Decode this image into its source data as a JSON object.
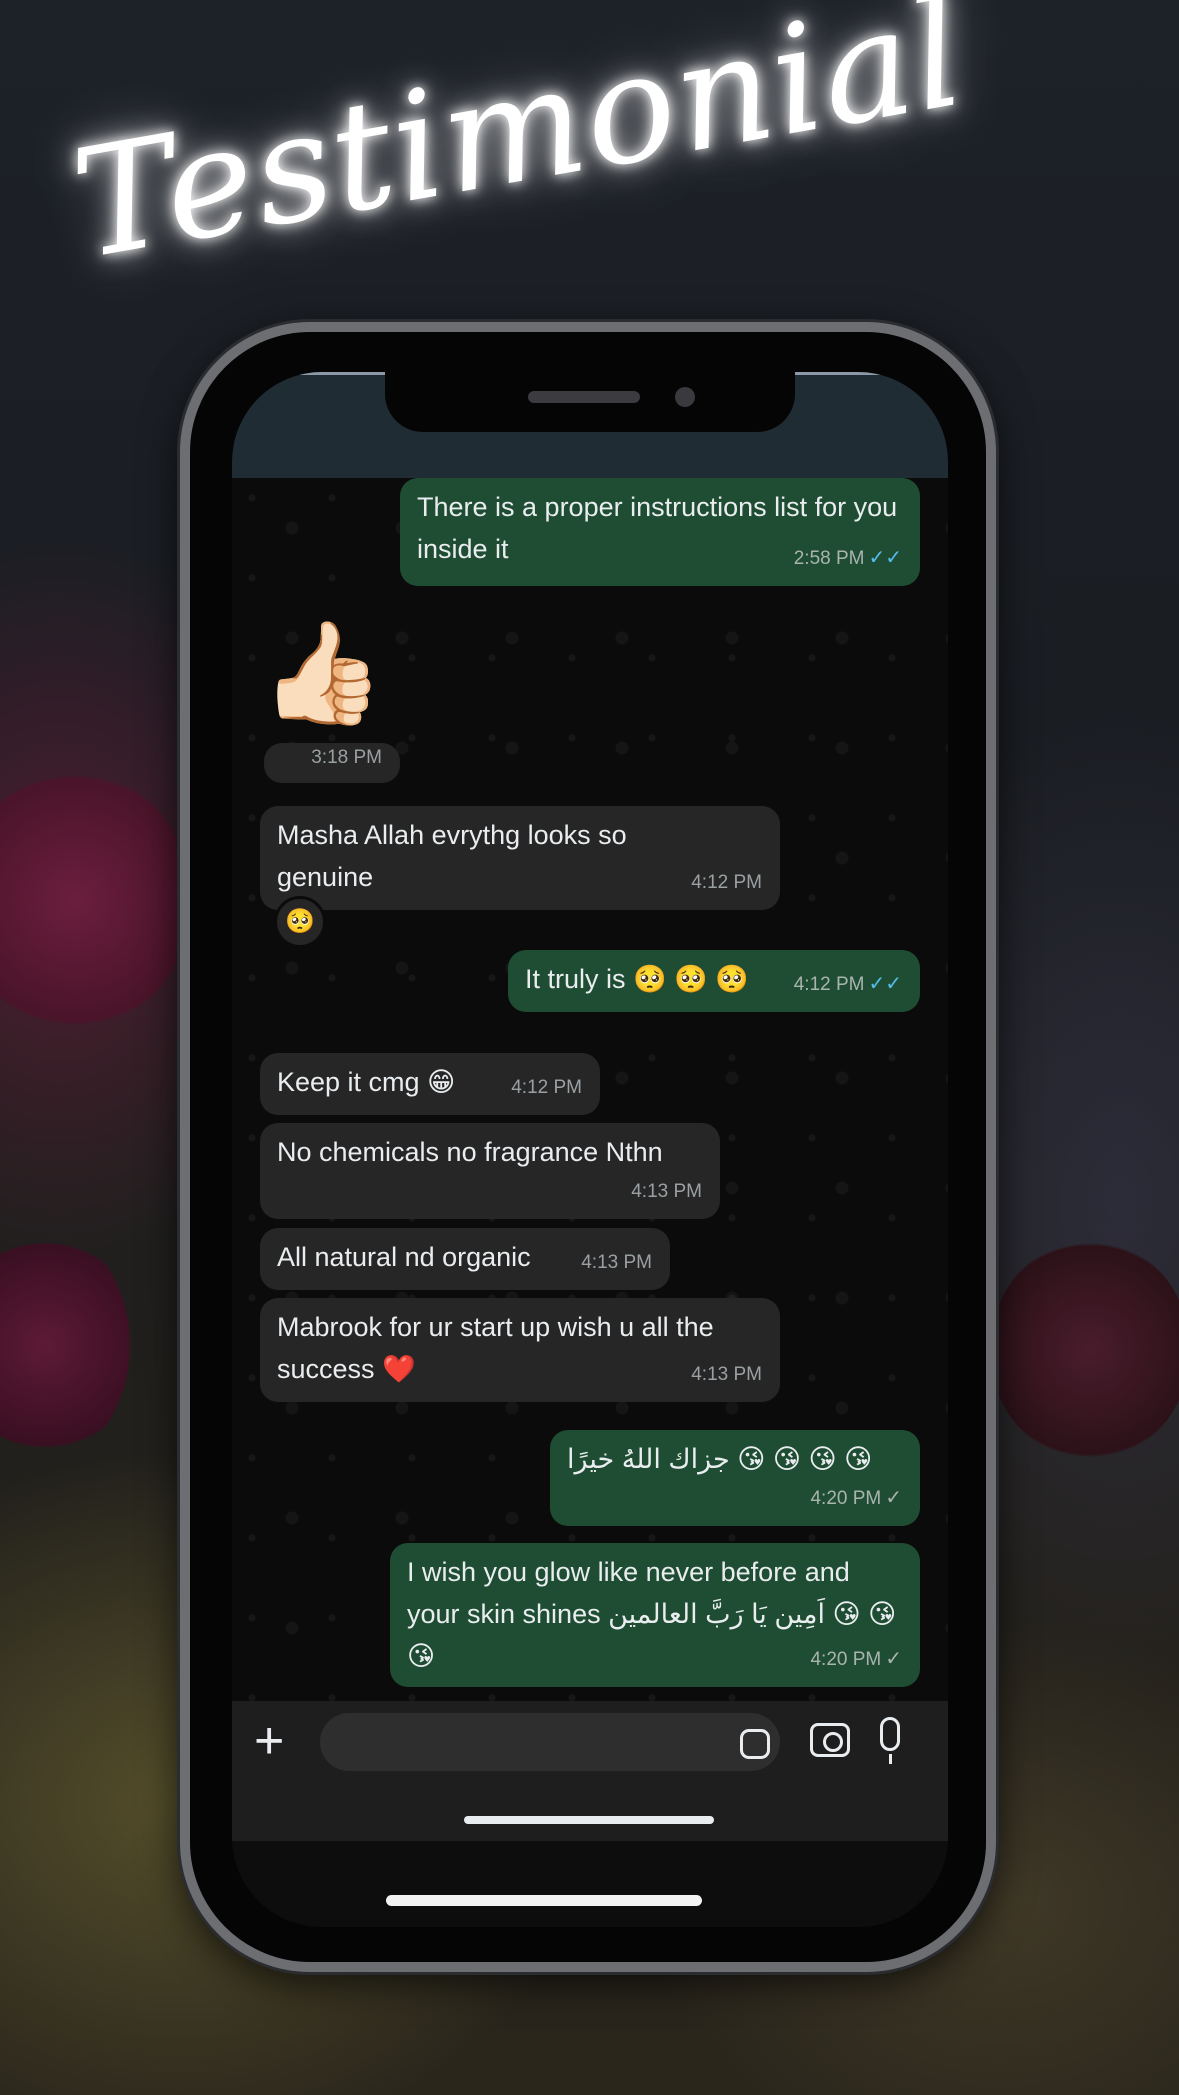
{
  "title": "Testimonial",
  "colors": {
    "outgoing_bubble": "#1f4d33",
    "incoming_bubble": "#262626",
    "read_tick": "#53bdeb"
  },
  "messages": [
    {
      "dir": "out",
      "text": "There is a proper instructions list for you inside it",
      "time": "2:58 PM",
      "status": "read"
    },
    {
      "dir": "in",
      "text": "👍🏻",
      "time": "3:18 PM"
    },
    {
      "dir": "in",
      "text": "Masha Allah evrythg looks so genuine",
      "time": "4:12 PM",
      "reaction": "🥺"
    },
    {
      "dir": "out",
      "text": "It truly is 🥺 🥺 🥺",
      "time": "4:12 PM",
      "status": "read"
    },
    {
      "dir": "in",
      "text": "Keep it cmg 😁",
      "time": "4:12 PM"
    },
    {
      "dir": "in",
      "text": "No chemicals no fragrance Nthn",
      "time": "4:13 PM"
    },
    {
      "dir": "in",
      "text": "All natural nd organic",
      "time": "4:13 PM"
    },
    {
      "dir": "in",
      "text": "Mabrook for ur start up wish u all the success ❤️",
      "time": "4:13 PM"
    },
    {
      "dir": "out",
      "text": "جزاك اللهُ خيرًا 😘 😘 😘 😘",
      "time": "4:20 PM",
      "status": "delivered"
    },
    {
      "dir": "out",
      "text": "I wish you glow like never before and your skin shines اَمِين يَا رَبَّ العالمين 😘 😘 😘",
      "time": "4:20 PM",
      "status": "delivered"
    }
  ],
  "composer": {
    "plus_icon": "plus-icon",
    "sticker_icon": "sticker-icon",
    "camera_icon": "camera-icon",
    "mic_icon": "microphone-icon"
  }
}
